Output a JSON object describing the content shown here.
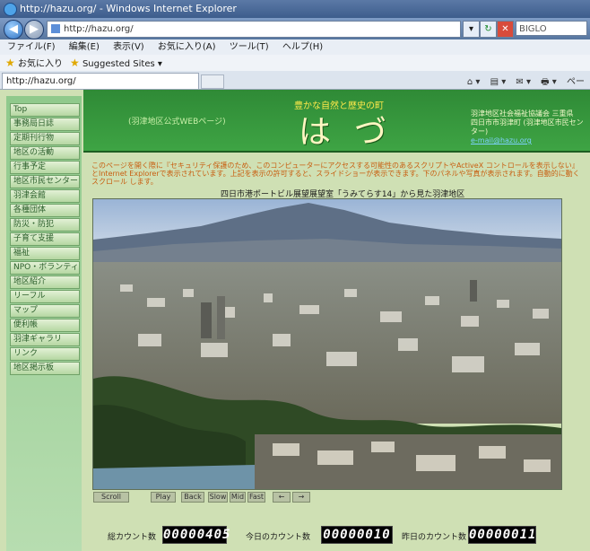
{
  "window": {
    "title": "http://hazu.org/ - Windows Internet Explorer"
  },
  "navigation": {
    "back_glyph": "◀",
    "forward_glyph": "▶",
    "address": "http://hazu.org/",
    "refresh_glyph": "↻",
    "stop_glyph": "✕",
    "dropdown_glyph": "▾",
    "search_placeholder": "BIGLO"
  },
  "menubar": {
    "items": [
      "ファイル(F)",
      "編集(E)",
      "表示(V)",
      "お気に入り(A)",
      "ツール(T)",
      "ヘルプ(H)"
    ]
  },
  "favorites_bar": {
    "favorites_label": "お気に入り",
    "suggested_sites_label": "Suggested Sites ▾"
  },
  "tabs": {
    "active_tab": "http://hazu.org/"
  },
  "command_bar": {
    "items": [
      "⌂ ▾",
      "▤ ▾",
      "✉ ▾",
      "🖶 ▾",
      "ペー"
    ]
  },
  "sidebar": {
    "items": [
      "Top",
      "事務局日誌",
      "定期刊行物",
      "地区の活動",
      "行事予定",
      "地区市民センター",
      "羽津会館",
      "各種団体",
      "防災・防犯",
      "子育て支援",
      "福祉",
      "NPO・ボランティア",
      "地区紹介",
      "リーフル",
      "マップ",
      "便利帳",
      "羽津ギャラリ",
      "リンク",
      "地区掲示板"
    ]
  },
  "banner": {
    "tagline": "豊かな自然と歴史の町",
    "subtitle": "(羽津地区公式WEBページ)",
    "logo": "はづ",
    "org_line1": "羽津地区社会福祉協議会 三重県",
    "org_line2": "四日市市羽津町 (羽津地区市民センター)",
    "email": "e-mail@hazu.org"
  },
  "notice": {
    "text": "このページを開く際に『セキュリティ保護のため、このコンピューターにアクセスする可能性のあるスクリプトやActiveX コントロールを表示しない』とInternet Explorerで表示されています。上記を表示の許可すると、スライドショーが表示できます。下のパネルや写真が表示されます。自動的に動くスクロール します。"
  },
  "photo": {
    "caption": "四日市港ポートビル展望展望室「うみてらす14」から見た羽津地区"
  },
  "slideshow_controls": {
    "buttons": [
      "Scroll",
      "Play",
      "Back",
      "Slow",
      "Mid",
      "Fast",
      "←",
      "→"
    ]
  },
  "counters": {
    "total_label": "総カウント数",
    "total_value": "00000405",
    "today_label": "今日のカウント数",
    "today_value": "00000010",
    "yesterday_label": "昨日のカウント数",
    "yesterday_value": "00000011"
  }
}
